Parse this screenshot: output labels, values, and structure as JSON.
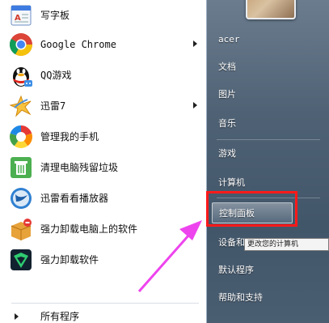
{
  "programs": [
    {
      "label": "写字板",
      "icon": "wordpad-icon",
      "submenu": false
    },
    {
      "label": "Google Chrome",
      "icon": "chrome-icon",
      "submenu": true
    },
    {
      "label": "QQ游戏",
      "icon": "qq-game-icon",
      "submenu": false
    },
    {
      "label": "迅雷7",
      "icon": "xunlei-icon",
      "submenu": true
    },
    {
      "label": "管理我的手机",
      "icon": "phone-manager-icon",
      "submenu": false
    },
    {
      "label": "清理电脑残留垃圾",
      "icon": "recycle-icon",
      "submenu": false
    },
    {
      "label": "迅雷看看播放器",
      "icon": "xunlei-player-icon",
      "submenu": false
    },
    {
      "label": "强力卸载电脑上的软件",
      "icon": "uninstall-box-icon",
      "submenu": false
    },
    {
      "label": "强力卸载软件",
      "icon": "uninstall-shield-icon",
      "submenu": false
    }
  ],
  "all_programs_label": "所有程序",
  "right_items": [
    {
      "label": "acer"
    },
    {
      "label": "文档"
    },
    {
      "label": "图片"
    },
    {
      "label": "音乐"
    },
    {
      "label": "游戏"
    },
    {
      "label": "计算机"
    },
    {
      "label": "控制面板"
    },
    {
      "label": "设备和"
    },
    {
      "label": "默认程序"
    },
    {
      "label": "帮助和支持"
    }
  ],
  "tooltip": "更改您的计算机",
  "colors": {
    "annotation_box": "#ff1a1a",
    "annotation_arrow": "#ee44ee",
    "right_pane": "#4f6275"
  }
}
